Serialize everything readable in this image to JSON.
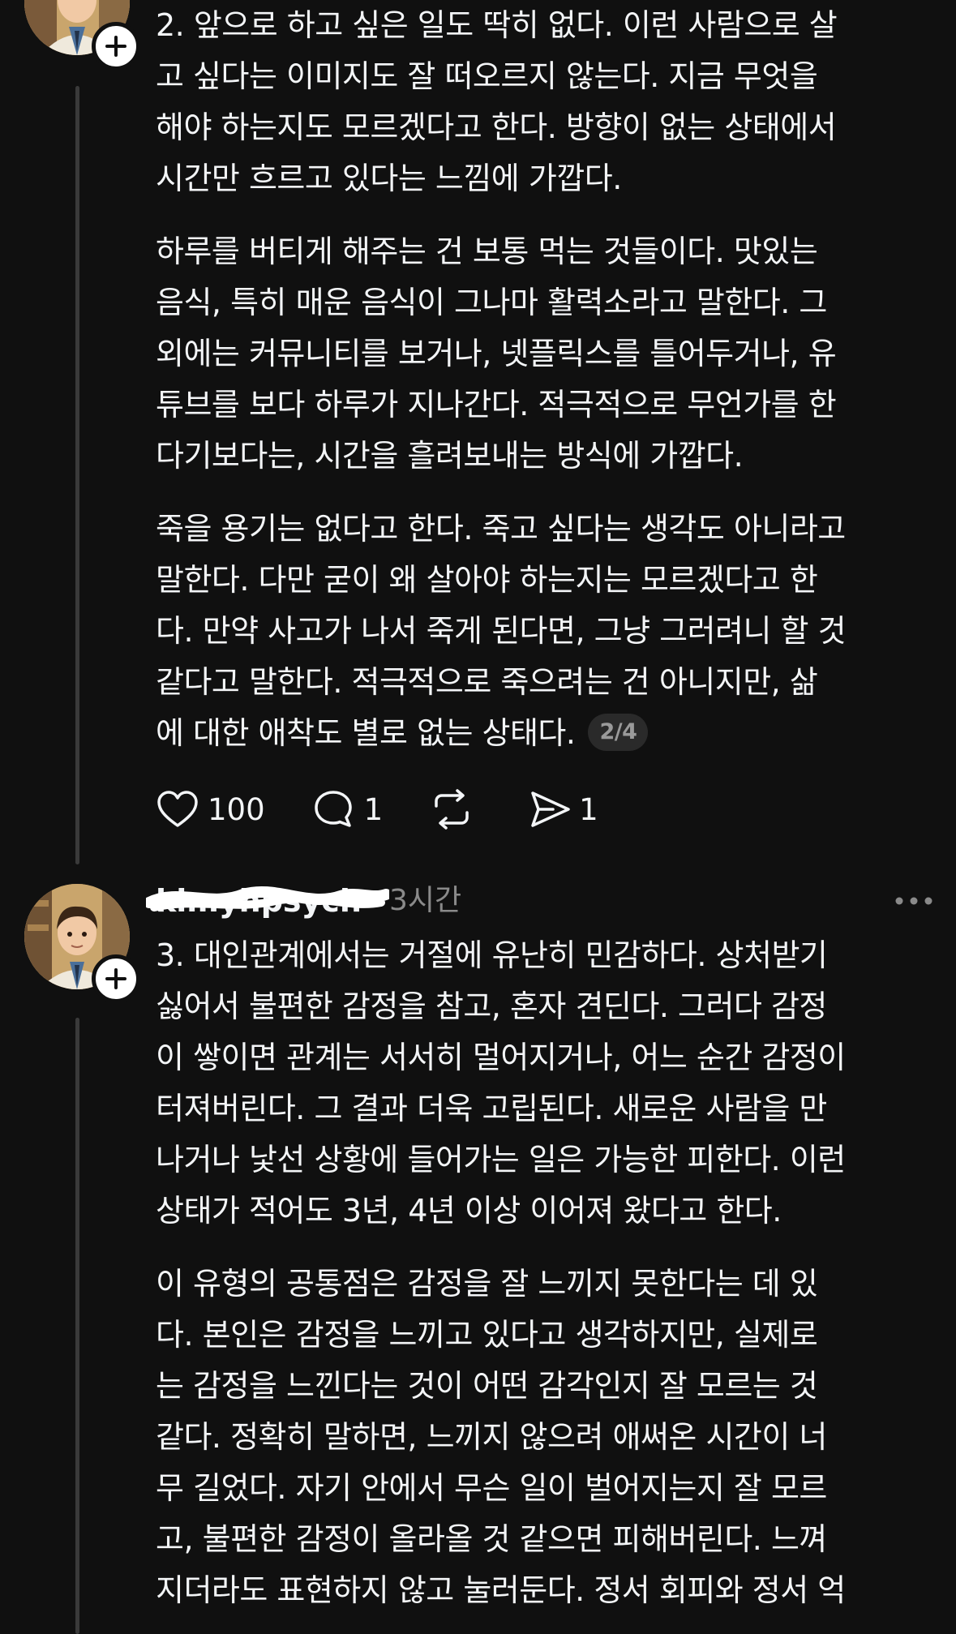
{
  "post_top": {
    "paragraphs": [
      "2. 앞으로 하고 싶은 일도 딱히 없다. 이런 사람으로 살\n고 싶다는 이미지도 잘 떠오르지 않는다. 지금 무엇을\n해야 하는지도 모르겠다고 한다. 방향이 없는 상태에서\n시간만 흐르고 있다는 느낌에 가깝다.",
      "하루를 버티게 해주는 건 보통 먹는 것들이다. 맛있는\n음식, 특히 매운 음식이 그나마 활력소라고 말한다. 그\n외에는 커뮤니티를 보거나, 넷플릭스를 틀어두거나, 유\n튜브를 보다 하루가 지나간다. 적극적으로 무언가를 한\n다기보다는, 시간을 흘려보내는 방식에 가깝다.",
      "죽을 용기는 없다고 한다. 죽고 싶다는 생각도 아니라고\n말한다. 다만 굳이 왜 살아야 하는지는 모르겠다고 한\n다. 만약 사고가 나서 죽게 된다면, 그냥 그러려니 할 것\n같다고 말한다. 적극적으로 죽으려는 건 아니지만, 삶\n에 대한 애착도 별로 없는 상태다."
    ],
    "page_indicator": "2/4",
    "actions": {
      "likes": "100",
      "replies": "1",
      "reposts": "",
      "shares": "1"
    }
  },
  "post_bottom": {
    "username": "kimyhpsych",
    "time": "3시간",
    "paragraphs": [
      "3. 대인관계에서는 거절에 유난히 민감하다. 상처받기\n싫어서 불편한 감정을 참고, 혼자 견딘다. 그러다 감정\n이 쌓이면 관계는 서서히 멀어지거나, 어느 순간 감정이\n터져버린다. 그 결과 더욱 고립된다. 새로운 사람을 만\n나거나 낯선 상황에 들어가는 일은 가능한 피한다. 이런\n상태가 적어도 3년, 4년 이상 이어져 왔다고 한다.",
      "이 유형의 공통점은 감정을 잘 느끼지 못한다는 데 있\n다. 본인은 감정을 느끼고 있다고 생각하지만, 실제로\n는 감정을 느낀다는 것이 어떤 감각인지 잘 모르는 것\n같다. 정확히 말하면, 느끼지 않으려 애써온 시간이 너\n무 길었다. 자기 안에서 무슨 일이 벌어지는지 잘 모르\n고, 불편한 감정이 올라올 것 같으면 피해버린다. 느껴\n지더라도 표현하지 않고 눌러둔다. 정서 회피와 정서 억"
    ]
  },
  "icons": {
    "follow": "plus-icon",
    "like": "heart-icon",
    "reply": "comment-icon",
    "repost": "repost-icon",
    "share": "send-icon",
    "more": "more-horizontal-icon"
  },
  "colors": {
    "background": "#101010",
    "text": "#f3f5f7",
    "muted": "#8a8a8a",
    "thread_line": "#3a3a3a"
  }
}
